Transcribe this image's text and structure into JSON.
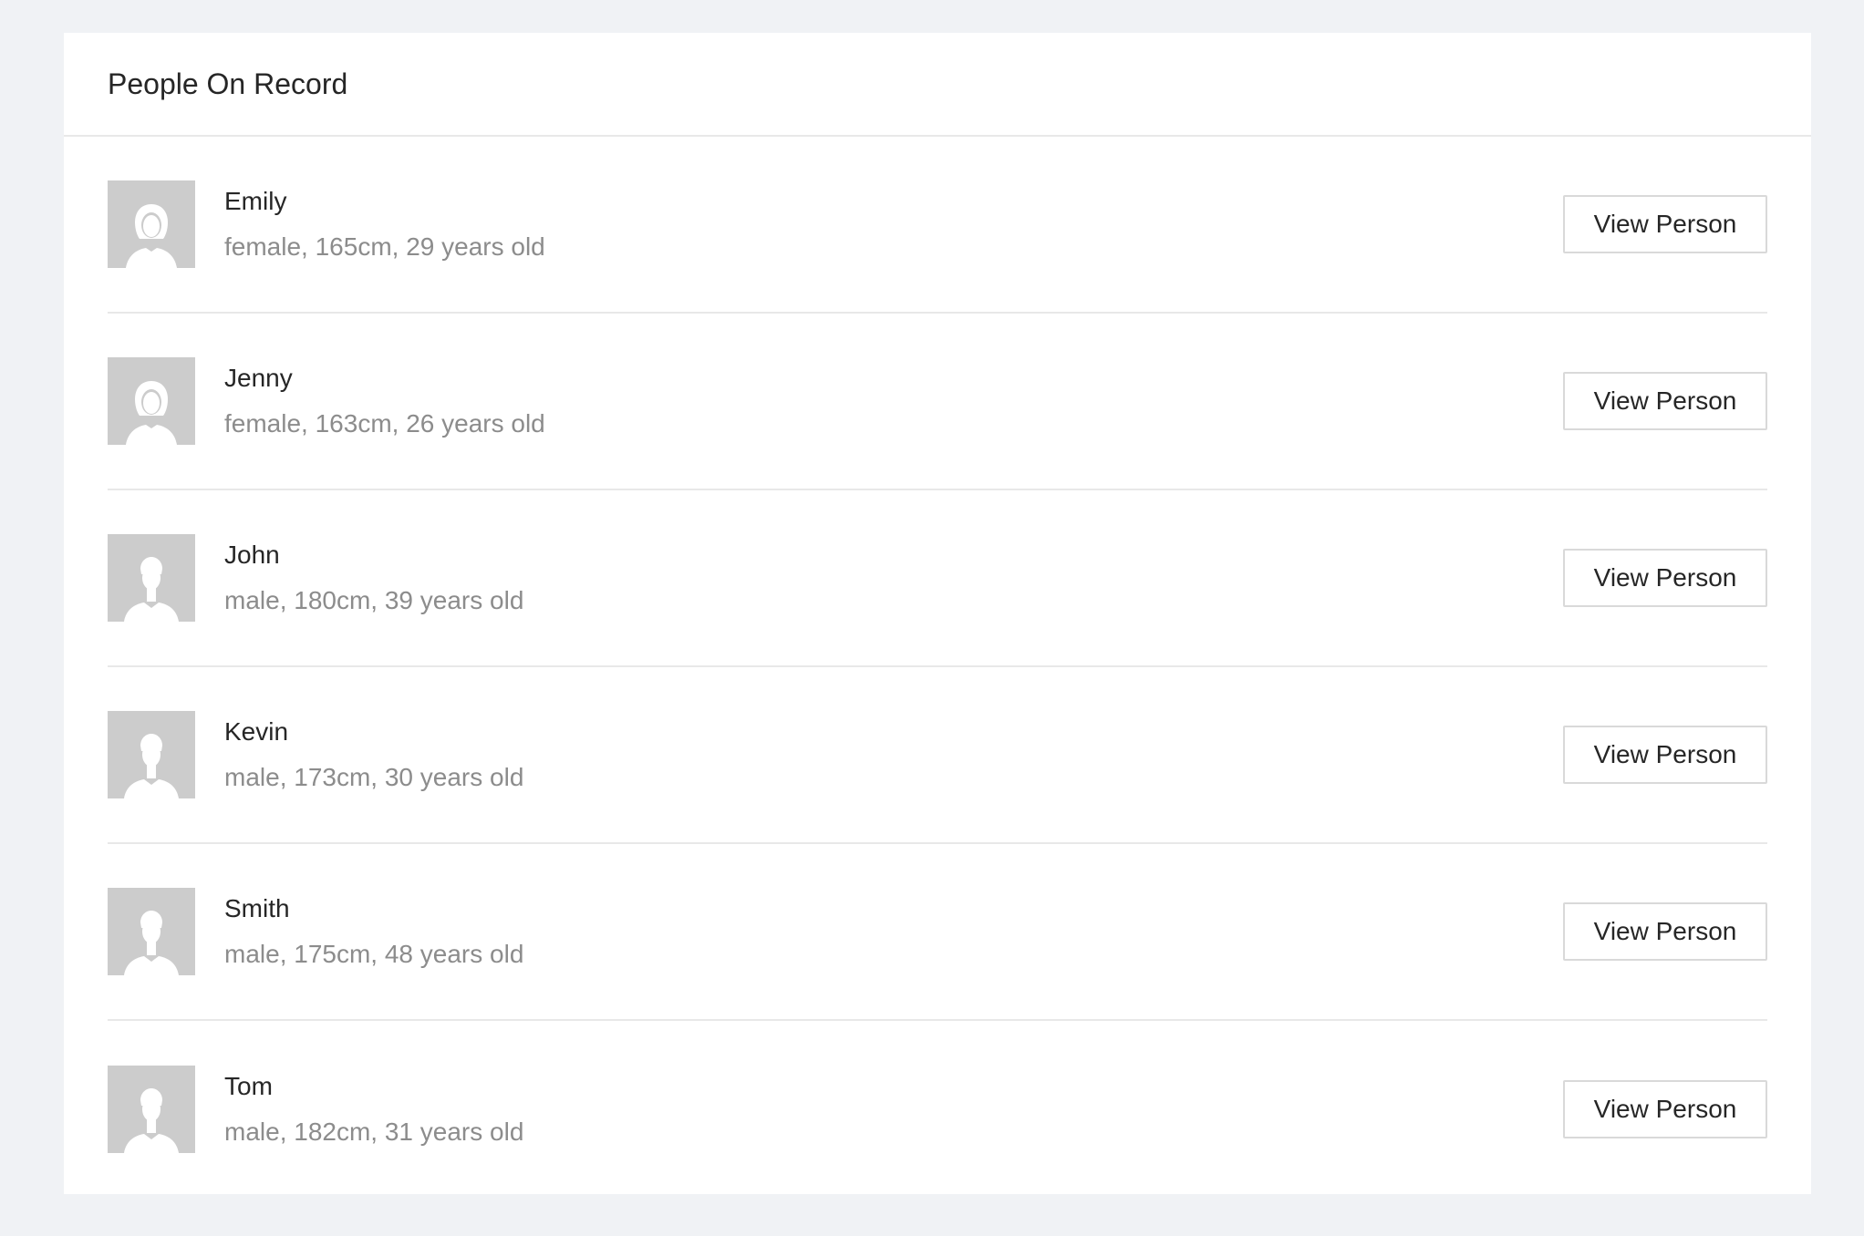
{
  "header": {
    "title": "People On Record"
  },
  "people": [
    {
      "name": "Emily",
      "description": "female, 165cm, 29 years old",
      "gender": "female",
      "avatar_icon": "female-avatar-icon",
      "button_label": "View Person"
    },
    {
      "name": "Jenny",
      "description": "female, 163cm, 26 years old",
      "gender": "female",
      "avatar_icon": "female-avatar-icon",
      "button_label": "View Person"
    },
    {
      "name": "John",
      "description": "male, 180cm, 39 years old",
      "gender": "male",
      "avatar_icon": "male-avatar-icon",
      "button_label": "View Person"
    },
    {
      "name": "Kevin",
      "description": "male, 173cm, 30 years old",
      "gender": "male",
      "avatar_icon": "male-avatar-icon",
      "button_label": "View Person"
    },
    {
      "name": "Smith",
      "description": "male, 175cm, 48 years old",
      "gender": "male",
      "avatar_icon": "male-avatar-icon",
      "button_label": "View Person"
    },
    {
      "name": "Tom",
      "description": "male, 182cm, 31 years old",
      "gender": "male",
      "avatar_icon": "male-avatar-icon",
      "button_label": "View Person"
    }
  ],
  "colors": {
    "page_background": "#f0f2f5",
    "card_background": "#ffffff",
    "avatar_background": "#cccccc",
    "divider": "#e8e8e8",
    "primary_text": "#262626",
    "secondary_text": "#8c8c8c"
  }
}
